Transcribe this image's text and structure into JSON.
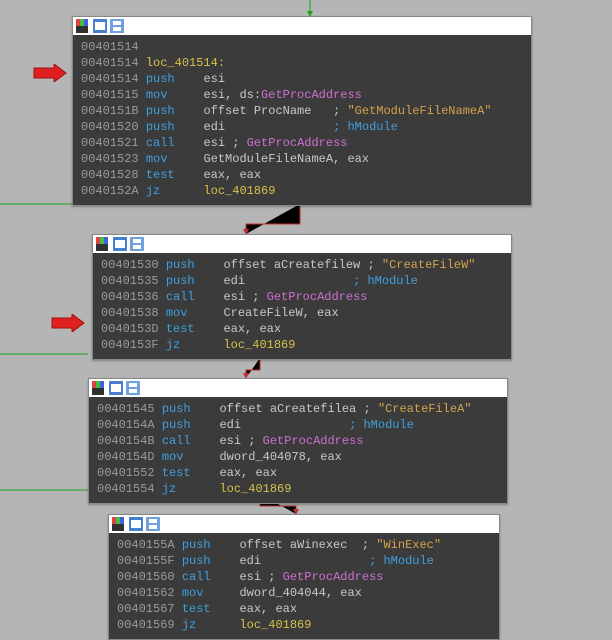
{
  "colors": {
    "addr": "#9a9a9a",
    "mnemonic": "#3fa0e0",
    "operand": "#c8c8c8",
    "function": "#d070d0",
    "string": "#d6a24a",
    "label": "#d6c04a"
  },
  "arrows": [
    {
      "target_line_addr": "00401514"
    },
    {
      "target_line_addr": "0040153D"
    }
  ],
  "blocks": [
    {
      "id": "b1",
      "lines": [
        {
          "addr": "00401514",
          "rest": ""
        },
        {
          "addr": "00401514",
          "label": "loc_401514:"
        },
        {
          "addr": "00401514",
          "mnem": "push",
          "op1": "esi"
        },
        {
          "addr": "00401515",
          "mnem": "mov",
          "op1": "esi, ds:",
          "fn": "GetProcAddress"
        },
        {
          "addr": "0040151B",
          "mnem": "push",
          "op1": "offset ProcName   ; ",
          "str": "\"GetModuleFileNameA\""
        },
        {
          "addr": "00401520",
          "mnem": "push",
          "op1": "edi               ",
          "cmt": "; hModule"
        },
        {
          "addr": "00401521",
          "mnem": "call",
          "op1": "esi ; ",
          "fn": "GetProcAddress"
        },
        {
          "addr": "00401523",
          "mnem": "mov",
          "op1": "GetModuleFileNameA, eax"
        },
        {
          "addr": "00401528",
          "mnem": "test",
          "op1": "eax, eax"
        },
        {
          "addr": "0040152A",
          "mnem": "jz",
          "lbl": "loc_401869"
        }
      ]
    },
    {
      "id": "b2",
      "lines": [
        {
          "addr": "00401530",
          "mnem": "push",
          "op1": "offset aCreatefilew ; ",
          "str": "\"CreateFileW\""
        },
        {
          "addr": "00401535",
          "mnem": "push",
          "op1": "edi               ",
          "cmt": "; hModule"
        },
        {
          "addr": "00401536",
          "mnem": "call",
          "op1": "esi ; ",
          "fn": "GetProcAddress"
        },
        {
          "addr": "00401538",
          "mnem": "mov",
          "op1": "CreateFileW, eax"
        },
        {
          "addr": "0040153D",
          "mnem": "test",
          "op1": "eax, eax"
        },
        {
          "addr": "0040153F",
          "mnem": "jz",
          "lbl": "loc_401869"
        }
      ]
    },
    {
      "id": "b3",
      "lines": [
        {
          "addr": "00401545",
          "mnem": "push",
          "op1": "offset aCreatefilea ; ",
          "str": "\"CreateFileA\""
        },
        {
          "addr": "0040154A",
          "mnem": "push",
          "op1": "edi               ",
          "cmt": "; hModule"
        },
        {
          "addr": "0040154B",
          "mnem": "call",
          "op1": "esi ; ",
          "fn": "GetProcAddress"
        },
        {
          "addr": "0040154D",
          "mnem": "mov",
          "op1": "dword_404078, eax"
        },
        {
          "addr": "00401552",
          "mnem": "test",
          "op1": "eax, eax"
        },
        {
          "addr": "00401554",
          "mnem": "jz",
          "lbl": "loc_401869"
        }
      ]
    },
    {
      "id": "b4",
      "lines": [
        {
          "addr": "0040155A",
          "mnem": "push",
          "op1": "offset aWinexec  ; ",
          "str": "\"WinExec\""
        },
        {
          "addr": "0040155F",
          "mnem": "push",
          "op1": "edi               ",
          "cmt": "; hModule"
        },
        {
          "addr": "00401560",
          "mnem": "call",
          "op1": "esi ; ",
          "fn": "GetProcAddress"
        },
        {
          "addr": "00401562",
          "mnem": "mov",
          "op1": "dword_404044, eax"
        },
        {
          "addr": "00401567",
          "mnem": "test",
          "op1": "eax, eax"
        },
        {
          "addr": "00401569",
          "mnem": "jz",
          "lbl": "loc_401869"
        }
      ]
    }
  ]
}
